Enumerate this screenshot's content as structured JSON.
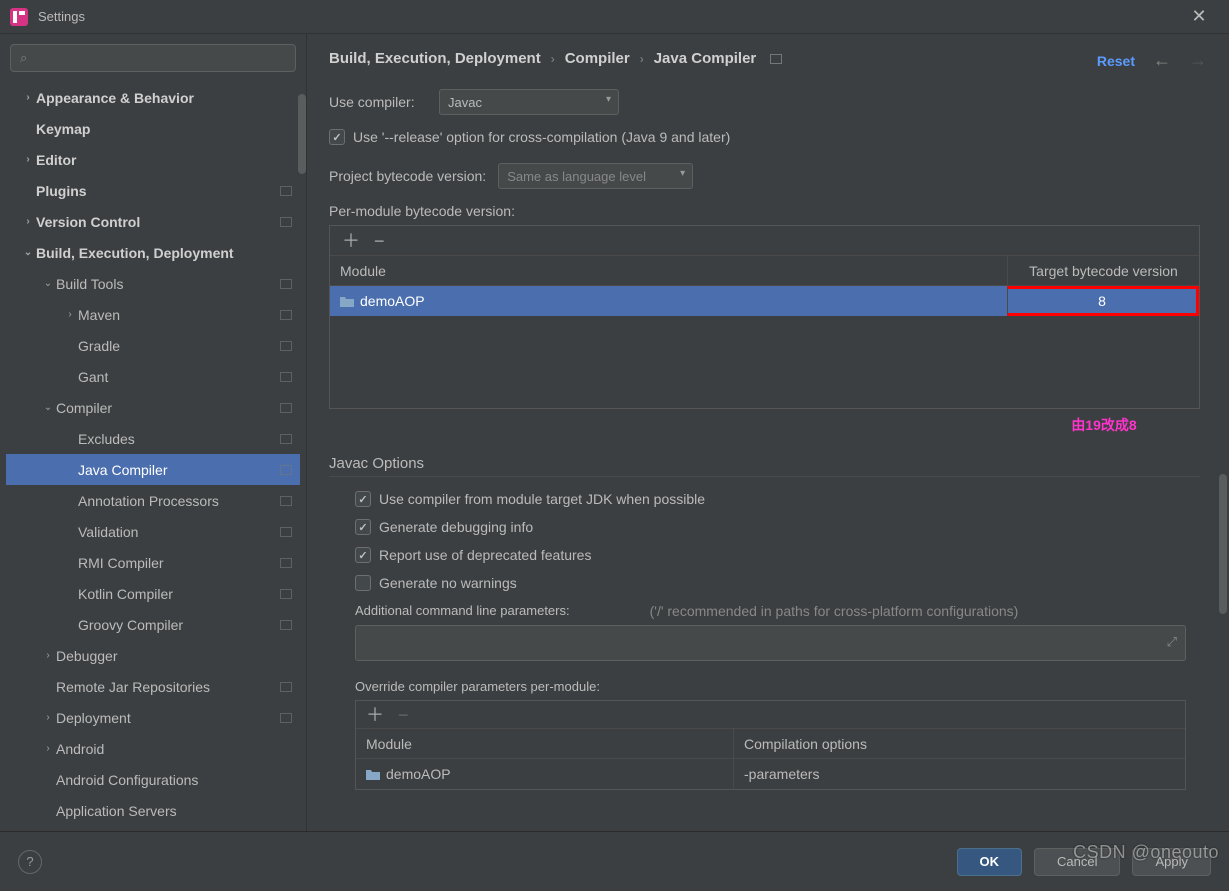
{
  "window": {
    "title": "Settings",
    "close_glyph": "✕"
  },
  "sidebar": {
    "search_placeholder": "",
    "items": [
      {
        "label": "Appearance & Behavior",
        "chev": "›",
        "indent": 0,
        "bold": true
      },
      {
        "label": "Keymap",
        "chev": "",
        "indent": 0,
        "bold": true
      },
      {
        "label": "Editor",
        "chev": "›",
        "indent": 0,
        "bold": true
      },
      {
        "label": "Plugins",
        "chev": "",
        "indent": 0,
        "bold": true,
        "badge": true
      },
      {
        "label": "Version Control",
        "chev": "›",
        "indent": 0,
        "bold": true,
        "badge": true
      },
      {
        "label": "Build, Execution, Deployment",
        "chev": "⌄",
        "indent": 0,
        "bold": true
      },
      {
        "label": "Build Tools",
        "chev": "⌄",
        "indent": 1,
        "badge": true
      },
      {
        "label": "Maven",
        "chev": "›",
        "indent": 2,
        "badge": true
      },
      {
        "label": "Gradle",
        "chev": "",
        "indent": 2,
        "badge": true
      },
      {
        "label": "Gant",
        "chev": "",
        "indent": 2,
        "badge": true
      },
      {
        "label": "Compiler",
        "chev": "⌄",
        "indent": 1,
        "badge": true
      },
      {
        "label": "Excludes",
        "chev": "",
        "indent": 2,
        "badge": true
      },
      {
        "label": "Java Compiler",
        "chev": "",
        "indent": 2,
        "badge": true,
        "selected": true
      },
      {
        "label": "Annotation Processors",
        "chev": "",
        "indent": 2,
        "badge": true
      },
      {
        "label": "Validation",
        "chev": "",
        "indent": 2,
        "badge": true
      },
      {
        "label": "RMI Compiler",
        "chev": "",
        "indent": 2,
        "badge": true
      },
      {
        "label": "Kotlin Compiler",
        "chev": "",
        "indent": 2,
        "badge": true
      },
      {
        "label": "Groovy Compiler",
        "chev": "",
        "indent": 2,
        "badge": true
      },
      {
        "label": "Debugger",
        "chev": "›",
        "indent": 1
      },
      {
        "label": "Remote Jar Repositories",
        "chev": "",
        "indent": 1,
        "badge": true
      },
      {
        "label": "Deployment",
        "chev": "›",
        "indent": 1,
        "badge": true
      },
      {
        "label": "Android",
        "chev": "›",
        "indent": 1
      },
      {
        "label": "Android Configurations",
        "chev": "",
        "indent": 1
      },
      {
        "label": "Application Servers",
        "chev": "",
        "indent": 1
      }
    ]
  },
  "breadcrumb": [
    "Build, Execution, Deployment",
    "Compiler",
    "Java Compiler"
  ],
  "nav": {
    "reset": "Reset",
    "back": "←",
    "fwd": "→"
  },
  "form": {
    "use_compiler_label": "Use compiler:",
    "use_compiler_value": "Javac",
    "release_option": "Use '--release' option for cross-compilation (Java 9 and later)",
    "project_bytecode_label": "Project bytecode version:",
    "project_bytecode_value": "Same as language level",
    "per_module_label": "Per-module bytecode version:",
    "col_module": "Module",
    "col_target": "Target bytecode version",
    "module_rows": [
      {
        "name": "demoAOP",
        "target": "8"
      }
    ],
    "annotation": "由19改成8"
  },
  "javac": {
    "section_title": "Javac Options",
    "opts": [
      {
        "label": "Use compiler from module target JDK when possible",
        "checked": true
      },
      {
        "label": "Generate debugging info",
        "checked": true
      },
      {
        "label": "Report use of deprecated features",
        "checked": true
      },
      {
        "label": "Generate no warnings",
        "checked": false
      }
    ],
    "additional_label": "Additional command line parameters:",
    "additional_hint": "('/' recommended in paths for cross-platform configurations)",
    "override_label": "Override compiler parameters per-module:",
    "override_col1": "Module",
    "override_col2": "Compilation options",
    "override_rows": [
      {
        "module": "demoAOP",
        "options": "-parameters"
      }
    ]
  },
  "footer": {
    "help": "?",
    "ok": "OK",
    "cancel": "Cancel",
    "apply": "Apply"
  },
  "watermark": "CSDN @oneouto"
}
